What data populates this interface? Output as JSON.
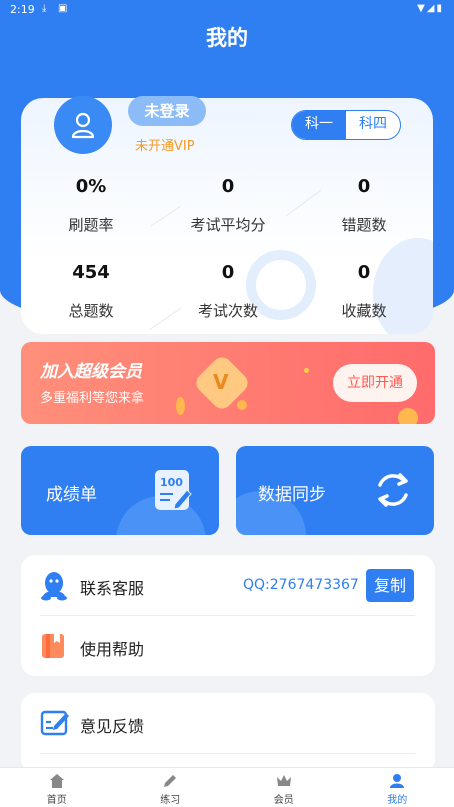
{
  "status_bar": {
    "time": "2:19"
  },
  "page": {
    "title": "我的"
  },
  "profile": {
    "login_label": "未登录",
    "vip_status": "未开通VIP",
    "subjects": [
      "科一",
      "科四"
    ],
    "stats": [
      {
        "value": "0%",
        "label": "刷题率"
      },
      {
        "value": "0",
        "label": "考试平均分"
      },
      {
        "value": "0",
        "label": "错题数"
      },
      {
        "value": "454",
        "label": "总题数"
      },
      {
        "value": "0",
        "label": "考试次数"
      },
      {
        "value": "0",
        "label": "收藏数"
      }
    ]
  },
  "vip_banner": {
    "title": "加入超级会员",
    "subtitle": "多重福利等您来拿",
    "button": "立即开通"
  },
  "tiles": {
    "report": "成绩单",
    "sync": "数据同步"
  },
  "support": {
    "contact_label": "联系客服",
    "qq": "QQ:2767473367",
    "copy": "复制",
    "help_label": "使用帮助"
  },
  "feedback": {
    "label": "意见反馈"
  },
  "tabbar": {
    "home": "首页",
    "practice": "练习",
    "member": "会员",
    "mine": "我的"
  },
  "colors": {
    "primary": "#2f7ff2",
    "vip_orange": "#f59a23",
    "banner_red": "#ff6b6b"
  }
}
